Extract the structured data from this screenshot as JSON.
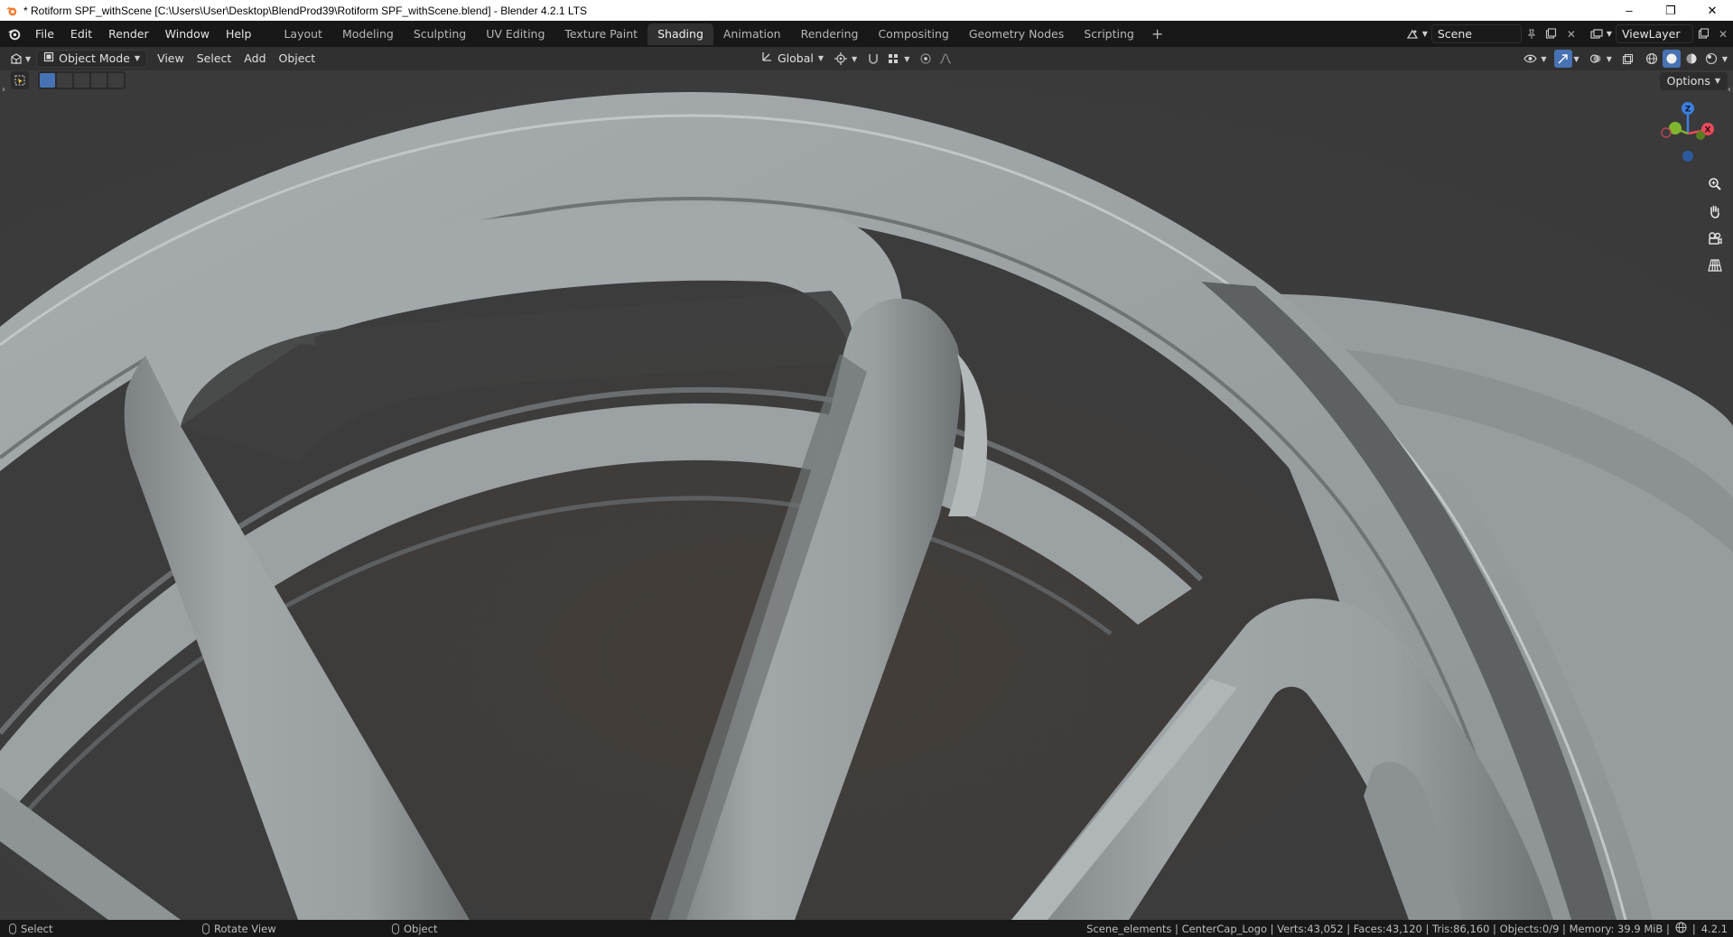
{
  "window": {
    "title": "* Rotiform SPF_withScene [C:\\Users\\User\\Desktop\\BlendProd39\\Rotiform SPF_withScene.blend] - Blender 4.2.1 LTS",
    "minimize": "–",
    "maximize": "❐",
    "close": "✕"
  },
  "menu": [
    "File",
    "Edit",
    "Render",
    "Window",
    "Help"
  ],
  "workspaces": [
    {
      "label": "Layout",
      "active": false
    },
    {
      "label": "Modeling",
      "active": false
    },
    {
      "label": "Sculpting",
      "active": false
    },
    {
      "label": "UV Editing",
      "active": false
    },
    {
      "label": "Texture Paint",
      "active": false
    },
    {
      "label": "Shading",
      "active": true
    },
    {
      "label": "Animation",
      "active": false
    },
    {
      "label": "Rendering",
      "active": false
    },
    {
      "label": "Compositing",
      "active": false
    },
    {
      "label": "Geometry Nodes",
      "active": false
    },
    {
      "label": "Scripting",
      "active": false
    }
  ],
  "workspace_add": "+",
  "scene": {
    "name": "Scene",
    "view_layer": "ViewLayer"
  },
  "viewport_header": {
    "mode": "Object Mode",
    "menus": [
      "View",
      "Select",
      "Add",
      "Object"
    ],
    "orientation": "Global"
  },
  "options_label": "Options",
  "gizmo": {
    "z": "Z",
    "x": "X",
    "y": "Y"
  },
  "statusbar": {
    "left": [
      {
        "label": "Select",
        "icon": "mouse-left-icon"
      },
      {
        "label": "Rotate View",
        "icon": "mouse-middle-icon"
      },
      {
        "label": "Object",
        "icon": "mouse-right-icon"
      }
    ],
    "stats": "Scene_elements | CenterCap_Logo | Verts:43,052 | Faces:43,120 | Tris:86,160 | Objects:0/9 | Memory: 39.9 MiB |",
    "version": "4.2.1"
  },
  "colors": {
    "accent": "#4772b3",
    "viewport_bg": "#3d3d3d",
    "mesh": "#9ea3a5",
    "axis_x": "#e84b5a",
    "axis_y": "#7fb62f",
    "axis_z": "#3b7fe0"
  }
}
